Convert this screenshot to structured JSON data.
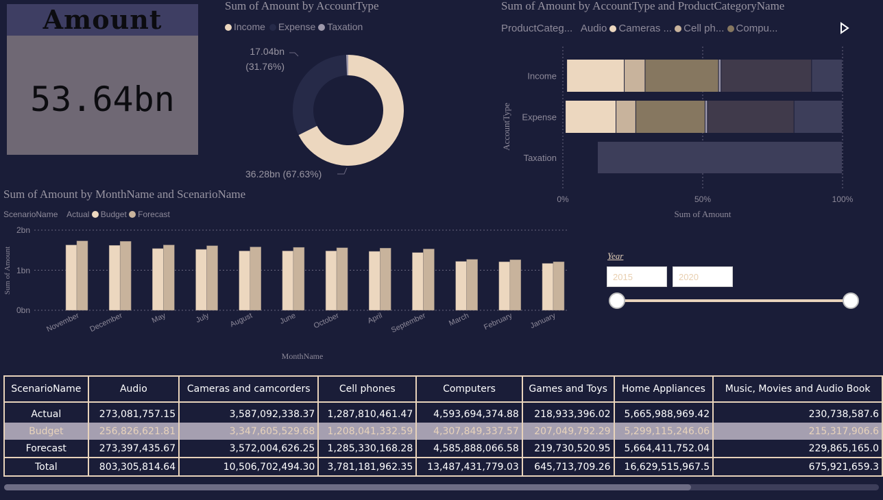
{
  "kpi": {
    "title": "Amount",
    "value": "53.64bn"
  },
  "donut": {
    "title": "Sum of Amount by AccountType",
    "legend": [
      {
        "label": "Income",
        "color": "#ecd7bf"
      },
      {
        "label": "Expense",
        "color": "#262a48"
      },
      {
        "label": "Taxation",
        "color": "#9e99ab"
      }
    ],
    "label_top_value": "17.04bn",
    "label_top_pct": "(31.76%)",
    "label_bottom": "36.28bn (67.63%)"
  },
  "stacked": {
    "title": "Sum of Amount by AccountType and ProductCategoryName",
    "legend_title": "ProductCateg...",
    "legend": [
      {
        "label": "Audio",
        "color": "#f0dbc2"
      },
      {
        "label": "Cameras ...",
        "color": "#ecd7bf"
      },
      {
        "label": "Cell ph...",
        "color": "#c8b39c"
      },
      {
        "label": "Compu...",
        "color": "#867760"
      }
    ],
    "ylabel": "AccountType",
    "xlabel": "Sum of Amount",
    "xticks": [
      "0%",
      "50%",
      "100%"
    ]
  },
  "columns": {
    "title": "Sum of Amount by MonthName and ScenarioName",
    "legend_title": "ScenarioName",
    "legend": [
      {
        "label": "Actual",
        "color": "#ecd7bf"
      },
      {
        "label": "Budget",
        "color": "#ecd7bf"
      },
      {
        "label": "Forecast",
        "color": "#c8b39c"
      }
    ],
    "yticks": [
      "0bn",
      "1bn",
      "2bn"
    ],
    "ylabel": "Sum of Amount",
    "xlabel": "MonthName"
  },
  "chart_data": [
    {
      "type": "pie",
      "title": "Sum of Amount by AccountType",
      "categories": [
        "Income",
        "Expense",
        "Taxation"
      ],
      "values": [
        36.28,
        17.04,
        0.32
      ],
      "unit": "bn"
    },
    {
      "type": "bar",
      "title": "Sum of Amount by AccountType and ProductCategoryName",
      "orientation": "horizontal-stacked-100",
      "categories": [
        "Income",
        "Expense",
        "Taxation"
      ],
      "series": [
        {
          "color": "#ecd7bf",
          "values": [
            23.5,
            20.5,
            0
          ]
        },
        {
          "color": "#c8b39c",
          "values": [
            8.5,
            8,
            0
          ]
        },
        {
          "color": "#867760",
          "values": [
            30,
            28,
            0
          ]
        },
        {
          "color": "#9e99ab",
          "values": [
            1,
            1,
            0
          ]
        },
        {
          "color": "#403a4b",
          "values": [
            37,
            35,
            0
          ]
        },
        {
          "color": "#3d3e5a",
          "values": [
            12.5,
            19.5,
            100
          ]
        }
      ],
      "xlim": [
        0,
        100
      ]
    },
    {
      "type": "bar",
      "title": "Sum of Amount by MonthName and ScenarioName",
      "categories": [
        "November",
        "December",
        "May",
        "July",
        "August",
        "June",
        "October",
        "April",
        "September",
        "March",
        "February",
        "January"
      ],
      "series": [
        {
          "name": "Budget",
          "values": [
            1.63,
            1.62,
            1.54,
            1.52,
            1.48,
            1.48,
            1.48,
            1.47,
            1.44,
            1.22,
            1.21,
            1.17
          ]
        },
        {
          "name": "Forecast",
          "values": [
            1.73,
            1.72,
            1.63,
            1.61,
            1.58,
            1.57,
            1.56,
            1.55,
            1.53,
            1.27,
            1.26,
            1.21
          ]
        }
      ],
      "ylim": [
        0,
        2
      ],
      "unit": "bn"
    }
  ],
  "slicer": {
    "label": "Year",
    "from": "2015",
    "to": "2020",
    "range": [
      0,
      1
    ]
  },
  "table": {
    "headers": [
      "ScenarioName",
      "Audio",
      "Cameras and camcorders",
      "Cell phones",
      "Computers",
      "Games and Toys",
      "Home Appliances",
      "Music, Movies and Audio Book"
    ],
    "rows": [
      [
        "Actual",
        "273,081,757.15",
        "3,587,092,338.37",
        "1,287,810,461.47",
        "4,593,694,374.88",
        "218,933,396.02",
        "5,665,988,969.42",
        "230,738,587.6"
      ],
      [
        "Budget",
        "256,826,621.81",
        "3,347,605,529.68",
        "1,208,041,332.59",
        "4,307,849,337.57",
        "207,049,792.29",
        "5,299,115,246.06",
        "215,317,906.6"
      ],
      [
        "Forecast",
        "273,397,435.67",
        "3,572,004,626.25",
        "1,285,330,168.28",
        "4,585,888,066.58",
        "219,730,520.95",
        "5,664,411,752.04",
        "229,865,165.0"
      ]
    ],
    "total": [
      "Total",
      "803,305,814.64",
      "10,506,702,494.30",
      "3,781,181,962.35",
      "13,487,431,779.03",
      "645,713,709.26",
      "16,629,515,967.5",
      "675,921,659.3"
    ]
  }
}
